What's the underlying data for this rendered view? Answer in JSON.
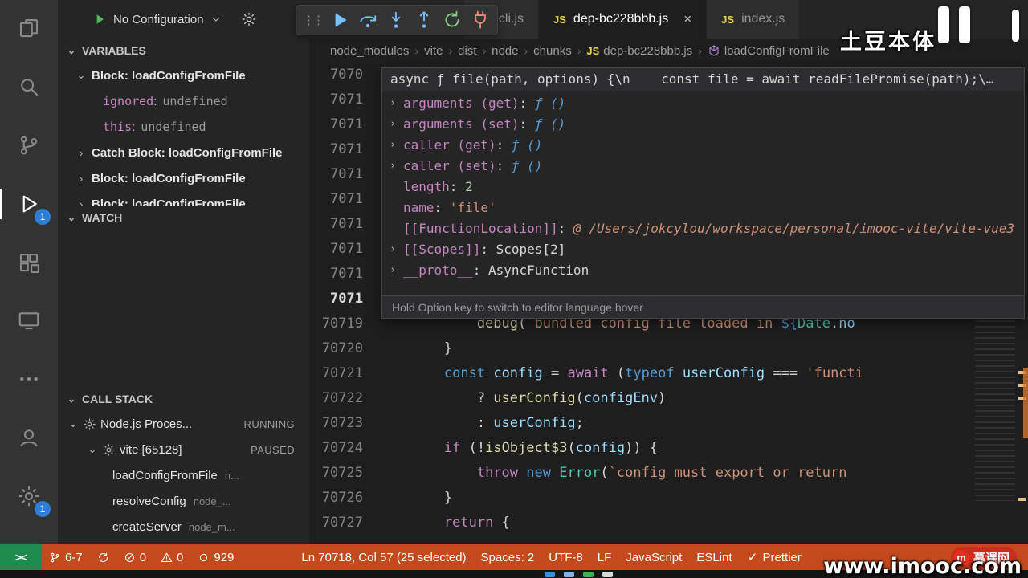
{
  "activity_bar": {
    "top": [
      {
        "name": "explorer",
        "icon": "files",
        "active": false
      },
      {
        "name": "search",
        "icon": "search",
        "active": false
      },
      {
        "name": "source-control",
        "icon": "branch",
        "active": false
      },
      {
        "name": "run-debug",
        "icon": "debug",
        "active": true,
        "badge": "1"
      },
      {
        "name": "extensions",
        "icon": "extensions",
        "active": false
      },
      {
        "name": "remote-explorer",
        "icon": "monitor",
        "active": false
      },
      {
        "name": "more-views",
        "icon": "ellipsis",
        "active": false
      }
    ],
    "bottom": [
      {
        "name": "accounts",
        "icon": "account",
        "active": false
      },
      {
        "name": "settings",
        "icon": "gear",
        "active": false,
        "badge": "1"
      }
    ]
  },
  "debug_bar": {
    "config_label": "No Configuration",
    "controls": [
      {
        "name": "continue",
        "color": "#75beff"
      },
      {
        "name": "step-over",
        "color": "#75beff"
      },
      {
        "name": "step-into",
        "color": "#75beff"
      },
      {
        "name": "step-out",
        "color": "#75beff"
      },
      {
        "name": "restart",
        "color": "#89d185"
      },
      {
        "name": "disconnect",
        "color": "#f48771"
      }
    ]
  },
  "tabs": [
    {
      "label": "cli.js",
      "active": false
    },
    {
      "label": "dep-bc228bbb.js",
      "active": true,
      "close": "×"
    },
    {
      "label": "index.js",
      "active": false
    }
  ],
  "breadcrumb": [
    {
      "label": "node_modules"
    },
    {
      "label": "vite"
    },
    {
      "label": "dist"
    },
    {
      "label": "node"
    },
    {
      "label": "chunks"
    },
    {
      "label": "dep-bc228bbb.js",
      "icon": "js"
    },
    {
      "label": "loadConfigFromFile",
      "icon": "cube"
    }
  ],
  "sidebar": {
    "variables": {
      "title": "VARIABLES",
      "rows": [
        {
          "type": "scope",
          "chev": "v",
          "label": "Block: loadConfigFromFile"
        },
        {
          "type": "kv",
          "name": "ignored",
          "value": "undefined"
        },
        {
          "type": "kv",
          "name": "this",
          "value": "undefined"
        },
        {
          "type": "scope",
          "chev": ">",
          "label": "Catch Block: loadConfigFromFile"
        },
        {
          "type": "scope",
          "chev": ">",
          "label": "Block: loadConfigFromFile"
        },
        {
          "type": "scope",
          "chev": ">",
          "label": "Block: loadConfigFromFile"
        }
      ]
    },
    "watch": {
      "title": "WATCH"
    },
    "call_stack": {
      "title": "CALL STACK",
      "rows": [
        {
          "type": "session",
          "chev": "v",
          "icon": "gear",
          "label": "Node.js Proces...",
          "status": "RUNNING",
          "indent": 0
        },
        {
          "type": "session",
          "chev": "v",
          "icon": "gear",
          "label": "vite [65128]",
          "status": "PAUSED",
          "indent": 1
        },
        {
          "type": "frame",
          "label": "loadConfigFromFile",
          "detail": "n..."
        },
        {
          "type": "frame",
          "label": "resolveConfig",
          "detail": "node_..."
        },
        {
          "type": "frame",
          "label": "createServer",
          "detail": "node_m..."
        }
      ]
    }
  },
  "hover": {
    "signature": "async ƒ file(path, options) {\\n    const file = await readFilePromise(path);\\…",
    "rows": [
      {
        "expand": true,
        "name": "arguments (get)",
        "value": "ƒ ()",
        "vclass": "fn"
      },
      {
        "expand": true,
        "name": "arguments (set)",
        "value": "ƒ ()",
        "vclass": "fn"
      },
      {
        "expand": true,
        "name": "caller (get)",
        "value": "ƒ ()",
        "vclass": "fn"
      },
      {
        "expand": true,
        "name": "caller (set)",
        "value": "ƒ ()",
        "vclass": "fn"
      },
      {
        "expand": false,
        "name": "length",
        "value": "2",
        "vclass": "num"
      },
      {
        "expand": false,
        "name": "name",
        "value": "'file'",
        "vclass": "str"
      },
      {
        "expand": false,
        "name": "[[FunctionLocation]]",
        "value": "@ /Users/jokcylou/workspace/personal/imooc-vite/vite-vue3",
        "vclass": "path"
      },
      {
        "expand": true,
        "name": "[[Scopes]]",
        "value": "Scopes[2]",
        "vclass": "plain"
      },
      {
        "expand": true,
        "name": "__proto__",
        "value": "AsyncFunction",
        "vclass": "plain"
      }
    ],
    "hint": "Hold Option key to switch to editor language hover"
  },
  "editor": {
    "lines": [
      {
        "num": "7070",
        "tokens": []
      },
      {
        "num": "7071",
        "tokens": []
      },
      {
        "num": "7071",
        "tokens": []
      },
      {
        "num": "7071",
        "tokens": []
      },
      {
        "num": "7071",
        "tokens": []
      },
      {
        "num": "7071",
        "tokens": []
      },
      {
        "num": "7071",
        "tokens": []
      },
      {
        "num": "7071",
        "tokens": []
      },
      {
        "num": "7071",
        "tokens": []
      },
      {
        "num": "7071",
        "current": true,
        "tokens": []
      },
      {
        "num": "70719",
        "tokens": [
          [
            "pln",
            "            "
          ],
          [
            "fn",
            "debug"
          ],
          [
            "pln",
            "("
          ],
          [
            "str",
            "`bundled config file loaded in "
          ],
          [
            "kw",
            "${"
          ],
          [
            "cls",
            "Date"
          ],
          [
            "var",
            ".no"
          ]
        ]
      },
      {
        "num": "70720",
        "tokens": [
          [
            "pln",
            "        }"
          ]
        ]
      },
      {
        "num": "70721",
        "tokens": [
          [
            "pln",
            "        "
          ],
          [
            "kw",
            "const"
          ],
          [
            "pln",
            " "
          ],
          [
            "var",
            "config"
          ],
          [
            "pln",
            " = "
          ],
          [
            "ctrl",
            "await"
          ],
          [
            "pln",
            " ("
          ],
          [
            "kw",
            "typeof"
          ],
          [
            "pln",
            " "
          ],
          [
            "var",
            "userConfig"
          ],
          [
            "pln",
            " === "
          ],
          [
            "str",
            "'functi"
          ]
        ]
      },
      {
        "num": "70722",
        "tokens": [
          [
            "pln",
            "            ? "
          ],
          [
            "fn",
            "userConfig"
          ],
          [
            "pln",
            "("
          ],
          [
            "var",
            "configEnv"
          ],
          [
            "pln",
            ")"
          ]
        ]
      },
      {
        "num": "70723",
        "tokens": [
          [
            "pln",
            "            : "
          ],
          [
            "var",
            "userConfig"
          ],
          [
            "pln",
            ";"
          ]
        ]
      },
      {
        "num": "70724",
        "tokens": [
          [
            "pln",
            "        "
          ],
          [
            "ctrl",
            "if"
          ],
          [
            "pln",
            " (!"
          ],
          [
            "fn",
            "isObject$3"
          ],
          [
            "pln",
            "("
          ],
          [
            "var",
            "config"
          ],
          [
            "pln",
            ")) {"
          ]
        ]
      },
      {
        "num": "70725",
        "tokens": [
          [
            "pln",
            "            "
          ],
          [
            "ctrl",
            "throw"
          ],
          [
            "pln",
            " "
          ],
          [
            "kw",
            "new"
          ],
          [
            "pln",
            " "
          ],
          [
            "cls",
            "Error"
          ],
          [
            "pln",
            "("
          ],
          [
            "str",
            "`config must export or return"
          ]
        ]
      },
      {
        "num": "70726",
        "tokens": [
          [
            "pln",
            "        }"
          ]
        ]
      },
      {
        "num": "70727",
        "tokens": [
          [
            "pln",
            "        "
          ],
          [
            "ctrl",
            "return"
          ],
          [
            "pln",
            " {"
          ]
        ]
      }
    ]
  },
  "status_bar": {
    "remote_label": "><",
    "left": [
      {
        "name": "git-branch",
        "icon": "branch-sm",
        "label": "6-7"
      },
      {
        "name": "sync",
        "icon": "sync",
        "label": ""
      },
      {
        "name": "errors",
        "icon": "error",
        "label": "0"
      },
      {
        "name": "warnings",
        "icon": "warning",
        "label": "0"
      },
      {
        "name": "counter",
        "icon": "record",
        "label": "929"
      }
    ],
    "right": [
      {
        "name": "cursor-position",
        "label": "Ln 70718, Col 57 (25 selected)"
      },
      {
        "name": "indentation",
        "label": "Spaces: 2"
      },
      {
        "name": "encoding",
        "label": "UTF-8"
      },
      {
        "name": "eol",
        "label": "LF"
      },
      {
        "name": "language",
        "label": "JavaScript"
      },
      {
        "name": "eslint",
        "label": "ESLint"
      },
      {
        "name": "prettier",
        "icon": "check",
        "label": "Prettier"
      }
    ]
  },
  "overlays": {
    "caption_top_right": "土豆本体",
    "watermark_text": "www.imooc.com",
    "brand_text": "慕课网"
  }
}
